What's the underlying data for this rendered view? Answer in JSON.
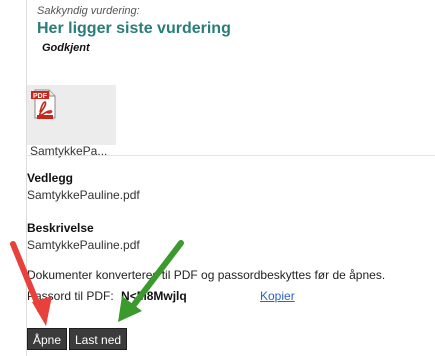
{
  "assessment": {
    "label": "Sakkyndig vurdering:",
    "title": "Her ligger siste vurdering",
    "status": "Godkjent"
  },
  "attachment_tile": {
    "icon": "pdf-icon",
    "name": "SamtykkePa..."
  },
  "fields": {
    "attachment_label": "Vedlegg",
    "attachment_value": "SamtykkePauline.pdf",
    "description_label": "Beskrivelse",
    "description_value": "SamtykkePauline.pdf"
  },
  "notice": "Dokumenter konverteres til PDF og passordbeskyttes før de åpnes.",
  "password": {
    "label": "Passord til PDF:",
    "value": "N<M8Mwjlq",
    "copy_label": "Kopier"
  },
  "buttons": {
    "open_label": "Åpne",
    "download_label": "Last ned"
  },
  "colors": {
    "heading": "#2a7d7a",
    "button_bg": "#3c3c3c",
    "link": "#2b63c8",
    "arrow_red": "#e8413c",
    "arrow_green": "#3a9a2c"
  }
}
